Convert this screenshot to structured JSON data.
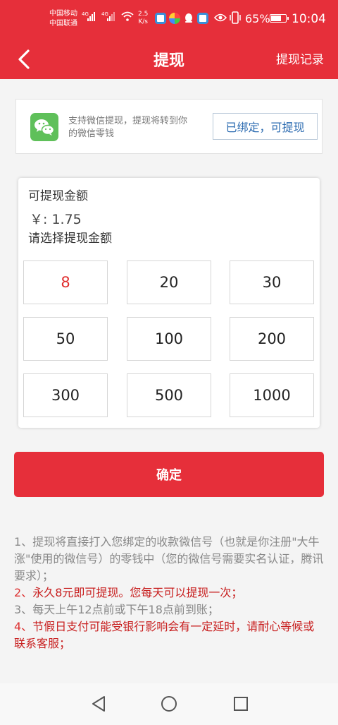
{
  "status_bar": {
    "carrier_1": "中国移动",
    "carrier_2": "中国联通",
    "net_1": "4G",
    "net_2": "4G",
    "speed_value": "2.5",
    "speed_unit": "K/s",
    "battery_percent": "65%",
    "battery_level": 0.65,
    "time": "10:04"
  },
  "nav": {
    "title": "提现",
    "records_link": "提现记录"
  },
  "wechat": {
    "description": "支持微信提现，提现将转到你的微信零钱",
    "bind_status": "已绑定，可提现"
  },
  "amount_panel": {
    "available_label": "可提现金额",
    "available_value": "￥: 1.75",
    "select_prompt": "请选择提现金额",
    "options": [
      "8",
      "20",
      "30",
      "50",
      "100",
      "200",
      "300",
      "500",
      "1000"
    ],
    "selected_option": "8"
  },
  "confirm_button": "确定",
  "notes": [
    {
      "num": "1、",
      "text": "提现将直接打入您绑定的收款微信号（也就是你注册\"大牛涨\"使用的微信号）的零钱中（您的微信号需要实名认证，腾讯要求）；"
    },
    {
      "num": "2、",
      "text": "永久8元即可提现。您每天可以提现一次；"
    },
    {
      "num": "3、",
      "text": "每天上午12点前或下午18点前到账；"
    },
    {
      "num": "4、",
      "text": "节假日支付可能受银行影响会有一定延时，请耐心等候或联系客服；"
    }
  ],
  "colors": {
    "brand_red": "#e62f3a",
    "note_red": "#c81e1e",
    "link_blue": "#2a6ab0",
    "wechat_green": "#5fc05a"
  },
  "icons": {
    "back": "chevron-left-icon",
    "wechat": "wechat-logo-icon",
    "sys_back": "triangle-back-icon",
    "sys_home": "circle-home-icon",
    "sys_recent": "square-recent-icon"
  }
}
